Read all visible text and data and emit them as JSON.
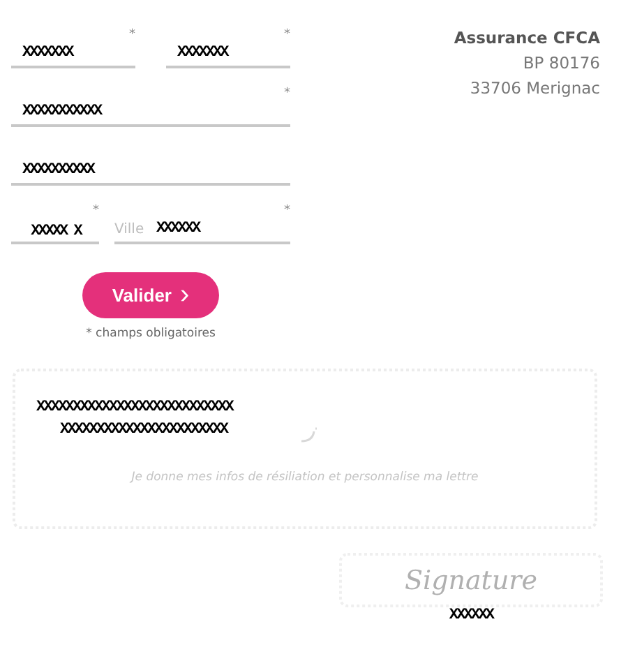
{
  "form": {
    "rows": [
      {
        "fields": [
          {
            "value": "XXXXXXX",
            "marker": "*"
          },
          {
            "value": "XXXXXXX",
            "marker": "*"
          }
        ]
      },
      {
        "fields": [
          {
            "value": "XXXXXXXXXXX",
            "marker": "*"
          }
        ]
      },
      {
        "fields": [
          {
            "value": "XXXXXXXXXX"
          }
        ]
      },
      {
        "fields": [
          {
            "value": "XXXXX X",
            "marker": "*"
          },
          {
            "label": "Ville",
            "value": "XXXXXX",
            "marker": "*"
          }
        ]
      }
    ],
    "submit": {
      "label": "Valider",
      "arrow": "›"
    },
    "required_note": "* champs obligatoires"
  },
  "recipient": {
    "name": "Assurance CFCA",
    "lines": [
      "BP 80176",
      "33706 Merignac"
    ]
  },
  "letter": {
    "redacted_lines": [
      "XXXXXXXXXXXXXXXXXXXXXXXXXXX",
      "XXXXXXXXXXXXXXXXXXXXXXX"
    ],
    "hint": "Je donne mes infos de résiliation et personnalise ma lettre"
  },
  "signature": {
    "label": "Signature",
    "caption": "XXXXXX"
  }
}
